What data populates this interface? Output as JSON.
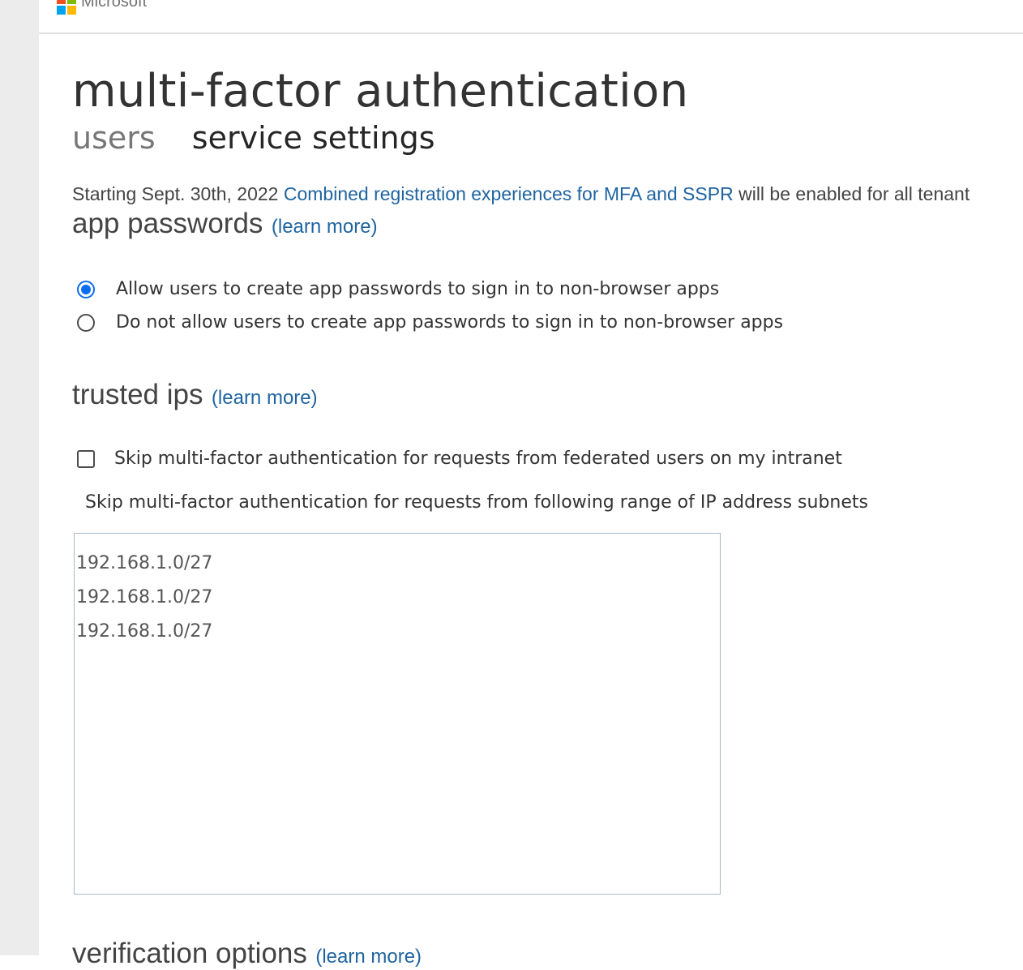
{
  "brand": {
    "name": "Microsoft",
    "logo_colors": [
      "#f25022",
      "#7fba00",
      "#00a4ef",
      "#ffb900"
    ]
  },
  "page": {
    "title": "multi-factor authentication",
    "tabs": [
      {
        "label": "users",
        "active": false
      },
      {
        "label": "service settings",
        "active": true
      }
    ]
  },
  "notice": {
    "prefix": "Starting Sept. 30th, 2022 ",
    "link_text": "Combined registration experiences for MFA and SSPR",
    "suffix": " will be enabled for all tenant"
  },
  "app_passwords": {
    "heading": "app passwords",
    "learn_more": "(learn more)",
    "options": [
      {
        "label": "Allow users to create app passwords to sign in to non-browser apps",
        "selected": true
      },
      {
        "label": "Do not allow users to create app passwords to sign in to non-browser apps",
        "selected": false
      }
    ]
  },
  "trusted_ips": {
    "heading": "trusted ips",
    "learn_more": "(learn more)",
    "skip_federated": {
      "label": "Skip multi-factor authentication for requests from federated users on my intranet",
      "checked": false
    },
    "subnets_label": "Skip multi-factor authentication for requests from following range of IP address subnets",
    "subnets": [
      "192.168.1.0/27",
      "192.168.1.0/27",
      "192.168.1.0/27"
    ]
  },
  "verification_options": {
    "heading": "verification options",
    "learn_more": "(learn more)"
  },
  "colors": {
    "link": "#1f64a0",
    "radio_accent": "#0a6cf0"
  }
}
